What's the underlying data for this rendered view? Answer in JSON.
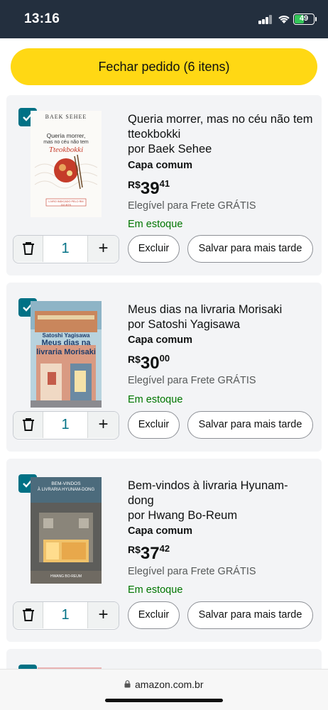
{
  "status_bar": {
    "time": "13:16",
    "battery": "49"
  },
  "checkout": {
    "label": "Fechar pedido (6 itens)"
  },
  "items": [
    {
      "title": "Queria morrer, mas no céu não tem tteokbokki",
      "author": "por Baek Sehee",
      "format": "Capa comum",
      "price_currency": "R$",
      "price_whole": "39",
      "price_cents": "41",
      "shipping": "Elegível para Frete GRÁTIS",
      "stock": "Em estoque",
      "quantity": "1",
      "cover": {
        "author": "BAEK SEHEE",
        "line1": "Queria morrer,",
        "line2": "mas no céu não tem",
        "script": "Tteokbokki",
        "badge": "LIVRO INDICADO PELO RM DO BTS"
      }
    },
    {
      "title": "Meus dias na livraria Morisaki",
      "author": "por Satoshi Yagisawa",
      "format": "Capa comum",
      "price_currency": "R$",
      "price_whole": "30",
      "price_cents": "00",
      "shipping": "Elegível para Frete GRÁTIS",
      "stock": "Em estoque",
      "quantity": "1",
      "cover": {
        "author": "Satoshi Yagisawa",
        "line1": "Meus dias na",
        "line2": "livraria Morisaki"
      }
    },
    {
      "title": "Bem-vindos à livraria Hyunam-dong",
      "author": "por Hwang Bo-Reum",
      "format": "Capa comum",
      "price_currency": "R$",
      "price_whole": "37",
      "price_cents": "42",
      "shipping": "Elegível para Frete GRÁTIS",
      "stock": "Em estoque",
      "quantity": "1",
      "cover": {
        "line1": "BEM-VINDOS",
        "line2": "À LIVRARIA HYUNAM-DONG",
        "author": "HWANG BO-REUM"
      }
    }
  ],
  "actions": {
    "delete": "Excluir",
    "save_later": "Salvar para mais tarde"
  },
  "browser": {
    "url": "amazon.com.br"
  },
  "colors": {
    "header": "#232f3e",
    "checkout": "#ffd814",
    "checkbox": "#007185",
    "stock": "#007600"
  }
}
